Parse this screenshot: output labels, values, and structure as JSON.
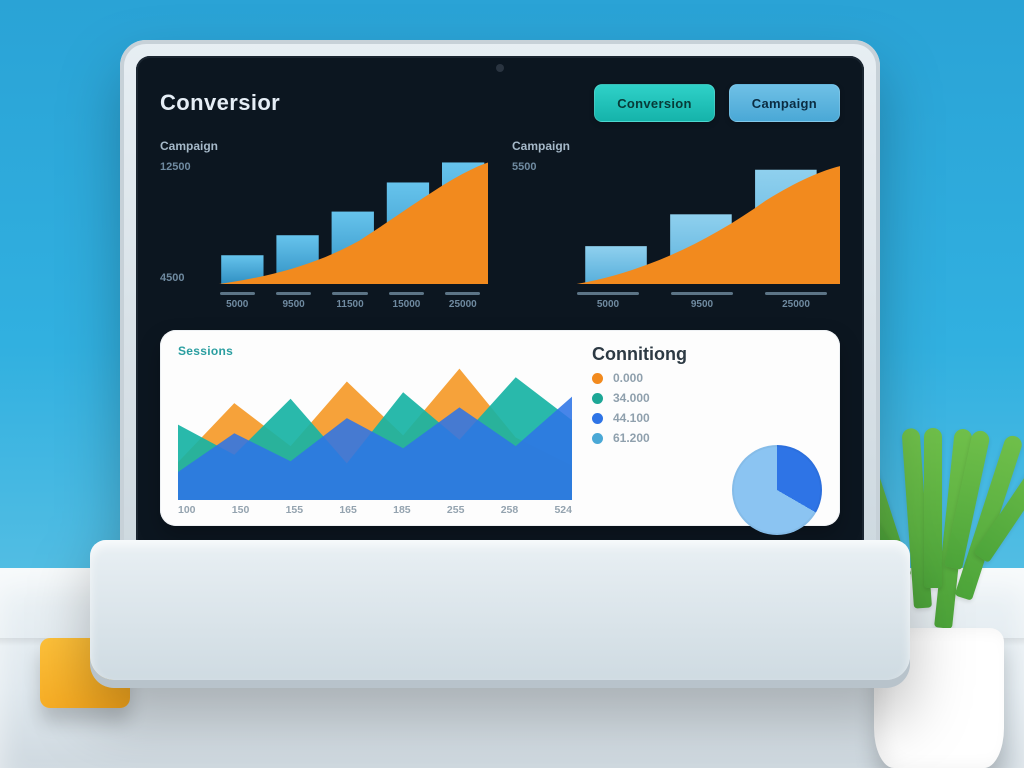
{
  "app": {
    "title": "Conversior"
  },
  "tabs": {
    "primary": "Conversion",
    "secondary": "Campaign"
  },
  "panel_left": {
    "label": "Campaign",
    "y_ticks": [
      "12500",
      "4500"
    ],
    "x_ticks": [
      "5000",
      "9500",
      "11500",
      "15000",
      "25000"
    ]
  },
  "panel_right": {
    "label": "Campaign",
    "y_ticks": [
      "5500"
    ],
    "x_ticks": [
      "5000",
      "9500",
      "25000"
    ]
  },
  "card": {
    "left_title": "Sessions",
    "x_ticks": [
      "100",
      "150",
      "155",
      "165",
      "185",
      "255",
      "258",
      "524"
    ],
    "right_title": "Connitiong",
    "legend": [
      {
        "color": "#f28a1e",
        "label": "0.000"
      },
      {
        "color": "#1da796",
        "label": "34.000"
      },
      {
        "color": "#2e74e6",
        "label": "44.100"
      },
      {
        "color": "#4aa8d6",
        "label": "61.200"
      }
    ],
    "pie": {
      "slice1_deg": 120,
      "colors": [
        "#2e74e6",
        "#8bc4f2"
      ]
    }
  },
  "chart_data": [
    {
      "type": "bar",
      "title": "Campaign",
      "categories": [
        "5000",
        "9500",
        "11500",
        "15000",
        "25000"
      ],
      "series": [
        {
          "name": "bars",
          "values": [
            3000,
            5000,
            7500,
            10500,
            12500
          ],
          "color": "#49b3e6"
        },
        {
          "name": "area",
          "values": [
            1500,
            3000,
            5000,
            8500,
            12500
          ],
          "color": "#f28a1e"
        }
      ],
      "ylabel": "",
      "xlabel": "",
      "ylim": [
        0,
        13000
      ],
      "y_ticks": [
        4500,
        12500
      ]
    },
    {
      "type": "bar",
      "title": "Campaign",
      "categories": [
        "5000",
        "9500",
        "25000"
      ],
      "series": [
        {
          "name": "bars",
          "values": [
            3000,
            5500,
            9000
          ],
          "color": "#49b3e6"
        },
        {
          "name": "area",
          "values": [
            1500,
            4500,
            9000
          ],
          "color": "#f28a1e"
        }
      ],
      "ylabel": "",
      "xlabel": "",
      "ylim": [
        0,
        10000
      ],
      "y_ticks": [
        5500
      ]
    },
    {
      "type": "area",
      "title": "Sessions",
      "x": [
        "100",
        "150",
        "155",
        "165",
        "185",
        "255",
        "258",
        "524"
      ],
      "series": [
        {
          "name": "orange",
          "color": "#f28a1e",
          "values": [
            30,
            70,
            40,
            85,
            55,
            95,
            50,
            30
          ]
        },
        {
          "name": "teal",
          "color": "#14b3a4",
          "values": [
            55,
            35,
            72,
            30,
            78,
            45,
            88,
            60
          ]
        },
        {
          "name": "blue",
          "color": "#2e74e6",
          "values": [
            20,
            48,
            28,
            58,
            38,
            66,
            42,
            74
          ]
        }
      ],
      "ylim": [
        0,
        100
      ]
    },
    {
      "type": "pie",
      "title": "Connitiong",
      "series": [
        {
          "name": "slice1",
          "value": 33,
          "color": "#2e74e6"
        },
        {
          "name": "slice2",
          "value": 67,
          "color": "#8bc4f2"
        }
      ]
    }
  ]
}
